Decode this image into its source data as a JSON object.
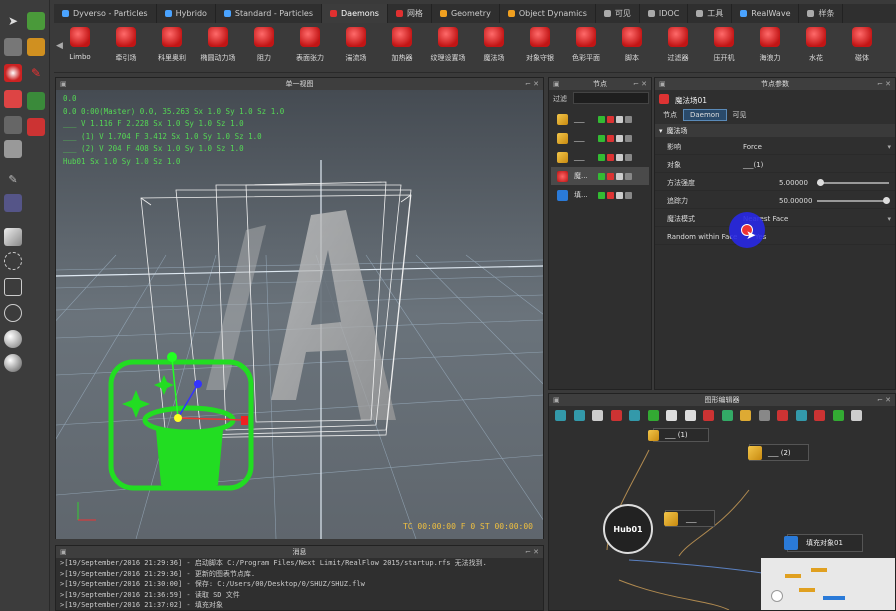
{
  "tabs": [
    {
      "label": "Dyverso - Particles",
      "color": "#4aa3ff"
    },
    {
      "label": "Hybrido",
      "color": "#4aa3ff"
    },
    {
      "label": "Standard - Particles",
      "color": "#4aa3ff"
    },
    {
      "label": "Daemons",
      "color": "#e03030",
      "active": true
    },
    {
      "label": "网格",
      "color": "#e03030"
    },
    {
      "label": "Geometry",
      "color": "#f0a020"
    },
    {
      "label": "Object Dynamics",
      "color": "#f0a020"
    },
    {
      "label": "可见",
      "color": "#aaaaaa"
    },
    {
      "label": "IDOC",
      "color": "#aaaaaa"
    },
    {
      "label": "工具",
      "color": "#aaaaaa"
    },
    {
      "label": "RealWave",
      "color": "#4aa3ff"
    },
    {
      "label": "样条",
      "color": "#aaaaaa"
    }
  ],
  "shelf": [
    "Limbo",
    "牵引场",
    "科里奥利",
    "椭圆动力场",
    "阻力",
    "表面张力",
    "湍流场",
    "加热器",
    "纹理设置场",
    "魔法场",
    "对象守银",
    "色彩平面",
    "脚本",
    "过滤器",
    "压开机",
    "海浪力",
    "水花",
    "碰体"
  ],
  "viewport": {
    "title": "单一视图",
    "hud": [
      "0.0",
      "0.0  0:00(Master) 0.0, 35.263 Sx 1.0 Sy 1.0 Sz 1.0",
      "___ V 1.116 F 2.228 Sx 1.0 Sy 1.0 Sz 1.0",
      "___ (1) V 1.704 F 3.412 Sx 1.0 Sy 1.0 Sz 1.0",
      "___ (2) V 204 F 408 Sx 1.0 Sy 1.0 Sz 1.0",
      "Hub01 Sx 1.0 Sy 1.0 Sz 1.0"
    ],
    "timecode": "TC 00:00:00   F 0   ST 00:00:00"
  },
  "console": {
    "title": "消息",
    "lines": [
      ">[19/September/2016 21:29:36] - 启动脚本 C:/Program Files/Next Limit/RealFlow 2015/startup.rfs 无法找到.",
      ">[19/September/2016 21:29:36] - 更新的图表节点库.",
      ">[19/September/2016 21:30:00] - 保存: C:/Users/00/Desktop/0/SHUZ/SHUZ.flw",
      ">[19/September/2016 21:36:59] - 读取 SD 文件",
      ">[19/September/2016 21:37:02] - 填充对象"
    ]
  },
  "nodes": {
    "title": "节点",
    "filter_label": "过滤",
    "items": [
      {
        "name": "___",
        "type": "cube"
      },
      {
        "name": "___",
        "type": "cube"
      },
      {
        "name": "___",
        "type": "cube"
      },
      {
        "name": "魔...",
        "type": "daemon"
      },
      {
        "name": "填...",
        "type": "fill"
      }
    ]
  },
  "params": {
    "title": "节点参数",
    "node_name": "魔法场01",
    "subtabs": [
      "节点",
      "Daemon",
      "可见"
    ],
    "section": "魔法场",
    "rows": [
      {
        "label": "影响",
        "value": "Force"
      },
      {
        "label": "对象",
        "value": "___(1)"
      },
      {
        "label": "方法强度",
        "value": "5.00000"
      },
      {
        "label": "追踪力",
        "value": "50.00000"
      },
      {
        "label": "魔法模式",
        "value": "Nearest Face"
      },
      {
        "label": "Random within Face",
        "value": "Yes"
      }
    ]
  },
  "graph": {
    "title": "图形编辑器",
    "nodes": [
      {
        "label": "___ (1)"
      },
      {
        "label": "___ (2)"
      },
      {
        "label": "___"
      },
      {
        "label": "Hub01"
      },
      {
        "label": "填充对象01"
      }
    ]
  }
}
